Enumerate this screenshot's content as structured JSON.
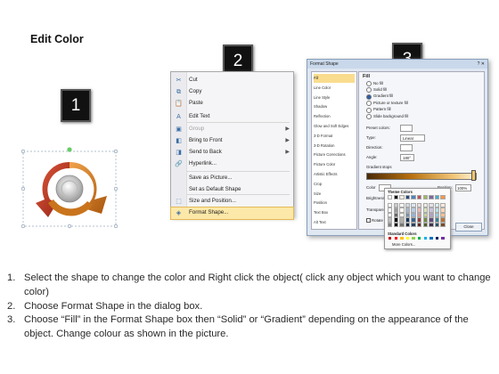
{
  "title": "Edit Color",
  "steps": {
    "one": "1",
    "two": "2",
    "three": "3"
  },
  "context_menu": {
    "items": [
      {
        "label": "Cut",
        "icon": "scissors-icon",
        "glyph": "✂"
      },
      {
        "label": "Copy",
        "icon": "copy-icon",
        "glyph": "⧉"
      },
      {
        "label": "Paste",
        "icon": "paste-icon",
        "glyph": "📋"
      },
      {
        "label": "Edit Text",
        "icon": "edit-text-icon",
        "glyph": "A"
      },
      {
        "label": "Group",
        "icon": "group-icon",
        "glyph": "▣",
        "disabled": true,
        "submenu": true
      },
      {
        "label": "Bring to Front",
        "icon": "bring-front-icon",
        "glyph": "◧",
        "submenu": true
      },
      {
        "label": "Send to Back",
        "icon": "send-back-icon",
        "glyph": "◨",
        "submenu": true
      },
      {
        "label": "Hyperlink...",
        "icon": "hyperlink-icon",
        "glyph": "🔗"
      },
      {
        "label": "Save as Picture...",
        "icon": "",
        "glyph": ""
      },
      {
        "label": "Set as Default Shape",
        "icon": "",
        "glyph": ""
      },
      {
        "label": "Size and Position...",
        "icon": "size-position-icon",
        "glyph": "⬚"
      },
      {
        "label": "Format Shape...",
        "icon": "format-shape-icon",
        "glyph": "◈"
      }
    ]
  },
  "dialog": {
    "title": "Format Shape",
    "categories": [
      "Fill",
      "Line Color",
      "Line Style",
      "Shadow",
      "Reflection",
      "Glow and Soft Edges",
      "3-D Format",
      "3-D Rotation",
      "Picture Corrections",
      "Picture Color",
      "Artistic Effects",
      "Crop",
      "Size",
      "Position",
      "Text Box",
      "Alt Text"
    ],
    "section": "Fill",
    "fill_options": [
      "No fill",
      "Solid fill",
      "Gradient fill",
      "Picture or texture fill",
      "Pattern fill",
      "Slide background fill"
    ],
    "preset_label": "Preset colors:",
    "type_label": "Type:",
    "type_value": "Linear",
    "direction_label": "Direction:",
    "angle_label": "Angle:",
    "angle_value": "180°",
    "stops_label": "Gradient stops",
    "color_label": "Color",
    "position_label": "Position:",
    "position_value": "100%",
    "brightness_label": "Brightness:",
    "transparency_label": "Transparency:",
    "rotate_label": "Rotate w",
    "close_label": "Close",
    "palette": {
      "theme_title": "Theme Colors",
      "standard_title": "Standard Colors",
      "more_label": "More Colors...",
      "theme_top": [
        "#ffffff",
        "#000000",
        "#eeece1",
        "#1f497d",
        "#4f81bd",
        "#c0504d",
        "#9bbb59",
        "#8064a2",
        "#4bacc6",
        "#f79646"
      ],
      "standard": [
        "#c00000",
        "#ff0000",
        "#ffc000",
        "#ffff00",
        "#92d050",
        "#00b050",
        "#00b0f0",
        "#0070c0",
        "#002060",
        "#7030a0"
      ]
    }
  },
  "instructions": [
    {
      "num": "1.",
      "text": "Select the shape to change the color and Right click the object( click any object which you want to change color)"
    },
    {
      "num": "2.",
      "text": "Choose Format Shape in the dialog box."
    },
    {
      "num": "3.",
      "text": "Choose “Fill” in the Format Shape box then “Solid” or “Gradient” depending on the appearance of the object. Change colour as shown in the picture."
    }
  ]
}
